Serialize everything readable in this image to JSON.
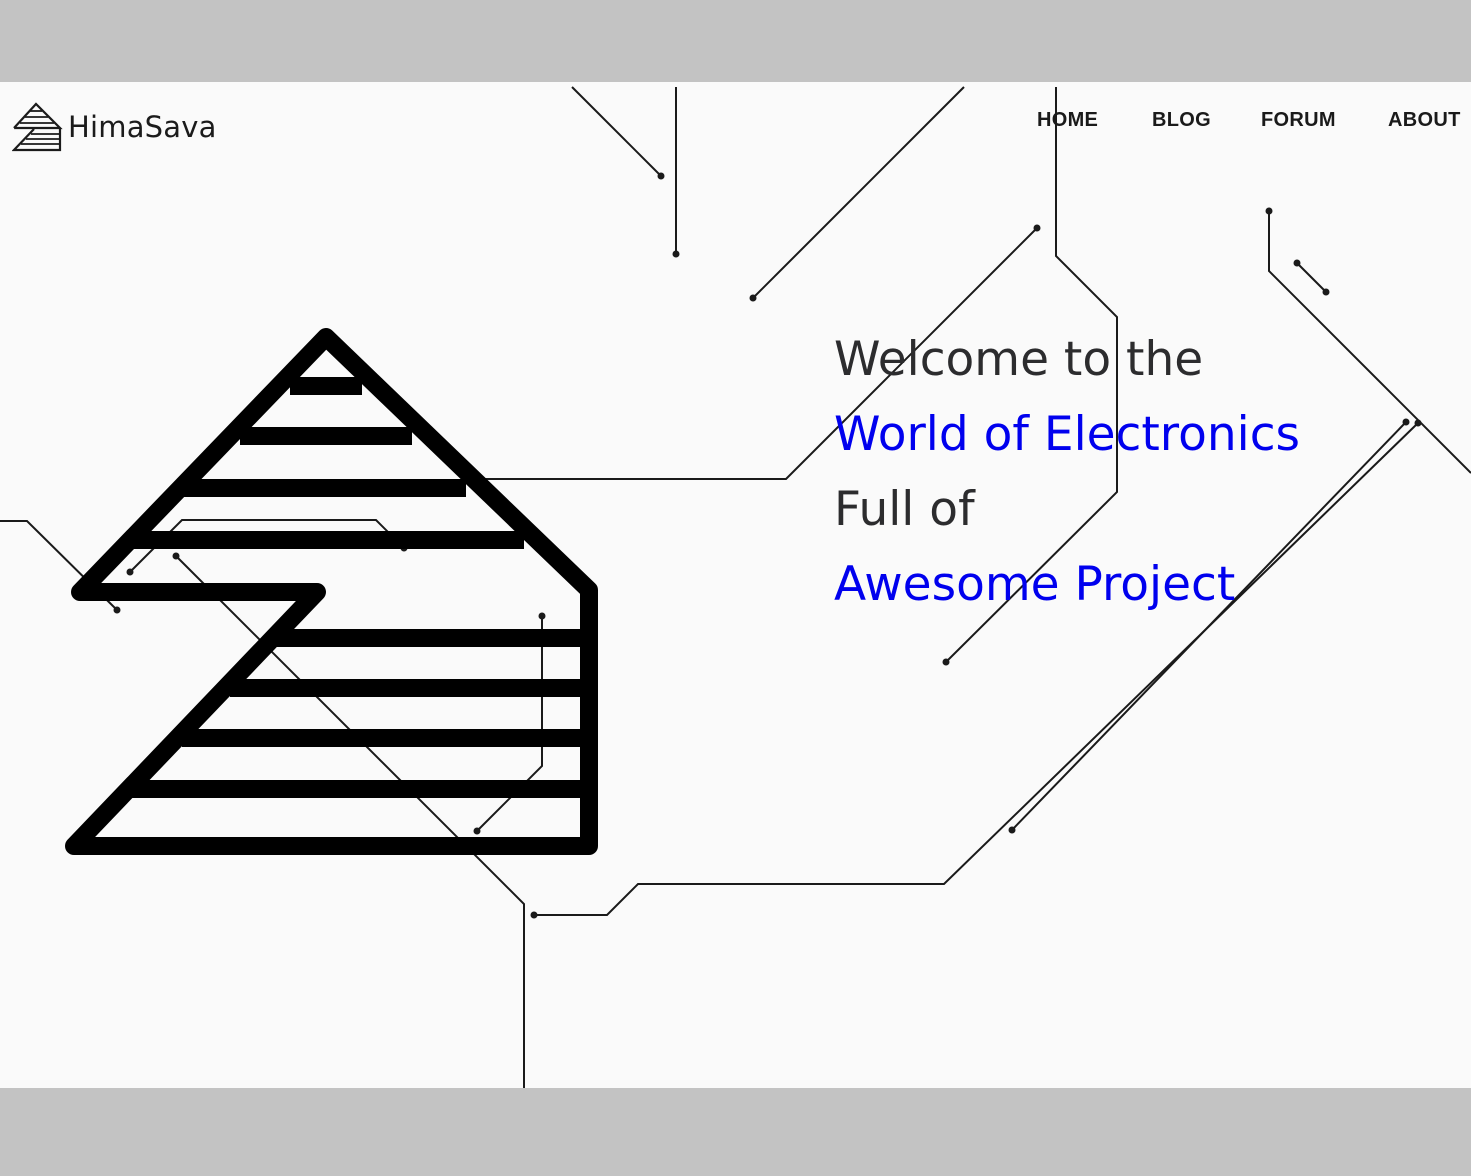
{
  "brand": {
    "name": "HimaSava",
    "logo_icon": "pyramid-logo-icon"
  },
  "nav": {
    "items": [
      {
        "label": "HOME"
      },
      {
        "label": "BLOG"
      },
      {
        "label": "FORUM"
      },
      {
        "label": "ABOUT"
      }
    ]
  },
  "hero": {
    "line1": "Welcome to the",
    "line2": "World of Electronics",
    "line3": "Full of",
    "line4": "Awesome Project"
  },
  "colors": {
    "background": "#fafafa",
    "letterbox": "#c3c3c3",
    "text_dark": "#2c2c2e",
    "accent_blue": "#0000ee",
    "lines": "#1a1a1a"
  },
  "graphics": {
    "hero_illustration": "striped-pyramid-illustration",
    "background_pattern": "circuit-traces"
  }
}
